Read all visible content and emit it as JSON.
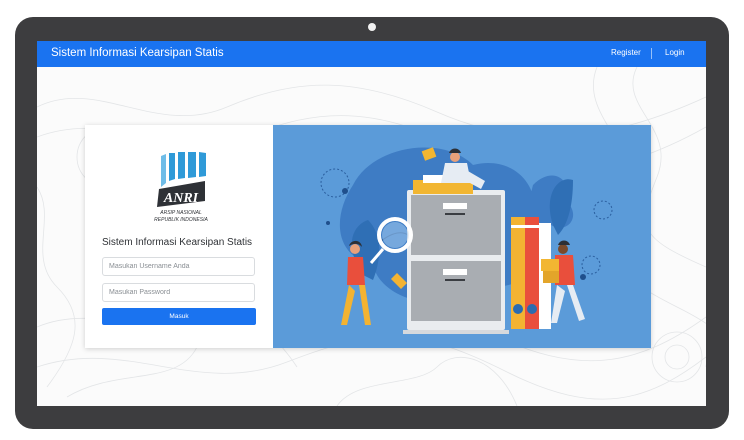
{
  "navbar": {
    "brand": "Sistem Informasi Kearsipan Statis",
    "register": "Register",
    "login": "Login"
  },
  "logo": {
    "letters": "ANRI",
    "line1": "ARSIP NASIONAL",
    "line2": "REPUBLIK INDONESIA"
  },
  "login_form": {
    "title": "Sistem Informasi Kearsipan Statis",
    "username_placeholder": "Masukan Username Anda",
    "password_placeholder": "Masukan Password",
    "submit_label": "Masuk"
  },
  "colors": {
    "navbar": "#1a73f0",
    "button": "#1a73f0",
    "illustration_bg": "#5b9bd9",
    "laptop_frame": "#3d3d3f"
  }
}
